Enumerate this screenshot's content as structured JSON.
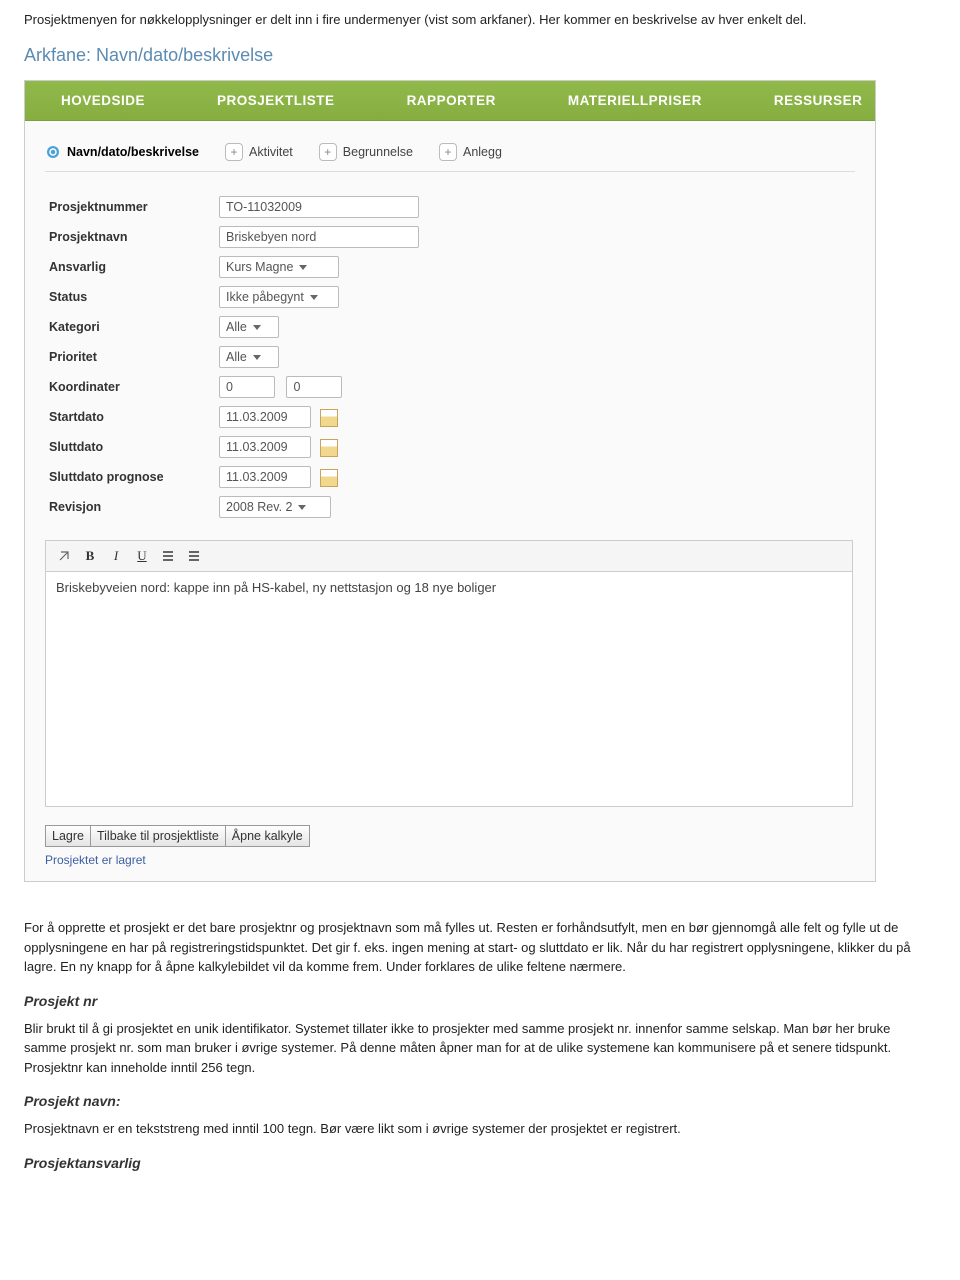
{
  "intro": "Prosjektmenyen for nøkkelopplysninger er delt inn i fire undermenyer (vist som arkfaner). Her kommer en beskrivelse av hver enkelt del.",
  "section_heading": "Arkfane: Navn/dato/beskrivelse",
  "nav": {
    "items": [
      "HOVEDSIDE",
      "PROSJEKTLISTE",
      "RAPPORTER",
      "MATERIELLPRISER",
      "RESSURSER"
    ]
  },
  "tabs": {
    "active": "Navn/dato/beskrivelse",
    "others": [
      "Aktivitet",
      "Begrunnelse",
      "Anlegg"
    ]
  },
  "form": {
    "prosjektnummer_label": "Prosjektnummer",
    "prosjektnummer_value": "TO-11032009",
    "prosjektnavn_label": "Prosjektnavn",
    "prosjektnavn_value": "Briskebyen nord",
    "ansvarlig_label": "Ansvarlig",
    "ansvarlig_value": "Kurs Magne",
    "status_label": "Status",
    "status_value": "Ikke påbegynt",
    "kategori_label": "Kategori",
    "kategori_value": "Alle",
    "prioritet_label": "Prioritet",
    "prioritet_value": "Alle",
    "koordinater_label": "Koordinater",
    "koord_x": "0",
    "koord_y": "0",
    "startdato_label": "Startdato",
    "startdato_value": "11.03.2009",
    "sluttdato_label": "Sluttdato",
    "sluttdato_value": "11.03.2009",
    "sluttprognose_label": "Sluttdato prognose",
    "sluttprognose_value": "11.03.2009",
    "revisjon_label": "Revisjon",
    "revisjon_value": "2008 Rev. 2"
  },
  "editor": {
    "content": "Briskebyveien nord: kappe inn på HS-kabel, ny nettstasjon og 18 nye boliger"
  },
  "buttons": {
    "lagre": "Lagre",
    "tilbake": "Tilbake til prosjektliste",
    "apne": "Åpne kalkyle"
  },
  "status_msg": "Prosjektet er lagret",
  "para1": "For å opprette et prosjekt er det bare prosjektnr og prosjektnavn som må fylles ut. Resten er forhåndsutfylt, men en bør gjennomgå alle felt og fylle ut de opplysningene en har på registreringstidspunktet. Det gir f. eks. ingen mening at start- og sluttdato er lik. Når du har registrert opplysningene, klikker du på lagre. En ny knapp for å åpne kalkylebildet vil da komme frem. Under forklares de ulike feltene nærmere.",
  "h_prosjektnr": "Prosjekt nr",
  "p_prosjektnr": "Blir brukt til å gi prosjektet en unik identifikator. Systemet tillater ikke to prosjekter med samme prosjekt nr. innenfor samme selskap. Man bør her bruke samme prosjekt nr. som man bruker i øvrige systemer. På denne måten åpner man for at de ulike systemene kan kommunisere på et senere tidspunkt. Prosjektnr kan inneholde inntil 256 tegn.",
  "h_prosjektnavn": "Prosjekt navn:",
  "p_prosjektnavn": "Prosjektnavn er en tekststreng med inntil 100 tegn. Bør være likt som i øvrige systemer der prosjektet er registrert.",
  "h_prosjektansvarlig": "Prosjektansvarlig"
}
